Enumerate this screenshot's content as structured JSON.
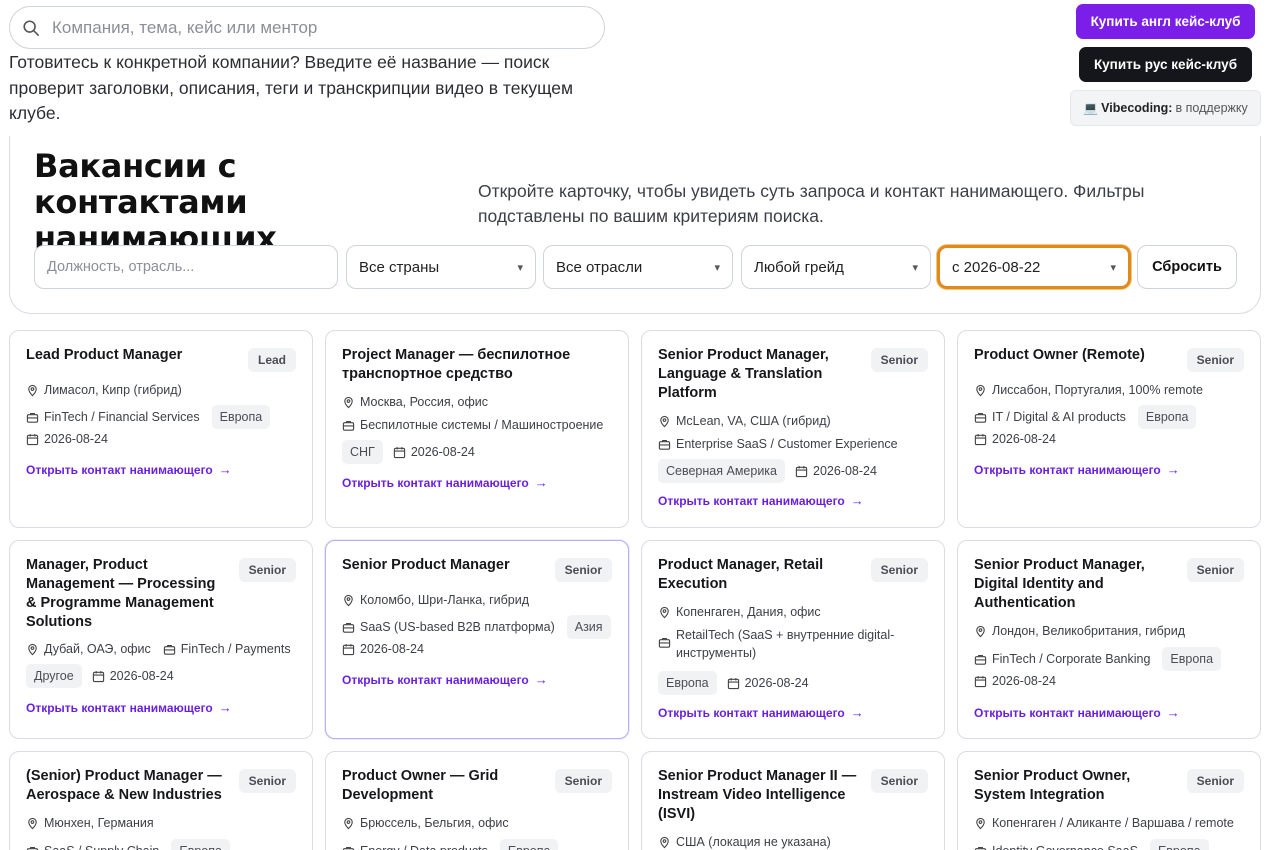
{
  "search": {
    "placeholder": "Компания, тема, кейс или ментор"
  },
  "hint": "Готовитесь к конкретной компании? Введите её название — поиск проверит заголовки, описания, теги и транскрипции видео в текущем клубе.",
  "buttons": {
    "buy_eng": "Купить англ кейс-клуб",
    "buy_rus": "Купить рус кейс-клуб",
    "vibecoding_label": "Vibecoding:",
    "vibecoding_text": "в поддержку"
  },
  "hero": {
    "title": "Вакансии с контактами нанимающих",
    "lead": "Откройте карточку, чтобы увидеть суть запроса и контакт нанимающего. Фильтры подставлены по вашим критериям поиска."
  },
  "filters": {
    "role_placeholder": "Должность, отрасль...",
    "country": "Все страны",
    "industry": "Все отрасли",
    "grade": "Любой грейд",
    "date": "с 2026-08-22",
    "reset": "Сбросить"
  },
  "open_link": "Открыть контакт нанимающего",
  "cards": [
    {
      "title": "Lead Product Manager",
      "grade": "Lead",
      "location": "Лимасол, Кипр (гибрид)",
      "industry": "FinTech / Financial Services",
      "region": "Европа",
      "date": "2026-08-24"
    },
    {
      "title": "Project Manager — беспилотное транспортное средство",
      "grade": "",
      "location": "Москва, Россия, офис",
      "industry": "Беспилотные системы / Машиностроение",
      "region": "СНГ",
      "date": "2026-08-24"
    },
    {
      "title": "Senior Product Manager, Language & Translation Platform",
      "grade": "Senior",
      "location": "McLean, VA, США (гибрид)",
      "industry": "Enterprise SaaS / Customer Experience",
      "region": "Северная Америка",
      "date": "2026-08-24"
    },
    {
      "title": "Product Owner (Remote)",
      "grade": "Senior",
      "location": "Лиссабон, Португалия, 100% remote",
      "industry": "IT / Digital & AI products",
      "region": "Европа",
      "date": "2026-08-24"
    },
    {
      "title": "Manager, Product Management — Processing & Programme Management Solutions",
      "grade": "Senior",
      "location": "Дубай, ОАЭ, офис",
      "industry": "FinTech / Payments",
      "region": "Другое",
      "date": "2026-08-24"
    },
    {
      "title": "Senior Product Manager",
      "grade": "Senior",
      "location": "Коломбо, Шри-Ланка, гибрид",
      "industry": "SaaS (US-based B2B платформа)",
      "region": "Азия",
      "date": "2026-08-24"
    },
    {
      "title": "Product Manager, Retail Execution",
      "grade": "Senior",
      "location": "Копенгаген, Дания, офис",
      "industry": "RetailTech (SaaS + внутренние digital-инструменты)",
      "region": "Европа",
      "date": "2026-08-24"
    },
    {
      "title": "Senior Product Manager, Digital Identity and Authentication",
      "grade": "Senior",
      "location": "Лондон, Великобритания, гибрид",
      "industry": "FinTech / Corporate Banking",
      "region": "Европа",
      "date": "2026-08-24"
    },
    {
      "title": "(Senior) Product Manager — Aerospace & New Industries",
      "grade": "Senior",
      "location": "Мюнхен, Германия",
      "industry": "SaaS / Supply Chain",
      "region": "Европа",
      "date": ""
    },
    {
      "title": "Product Owner — Grid Development",
      "grade": "Senior",
      "location": "Брюссель, Бельгия, офис",
      "industry": "Energy / Data products",
      "region": "Европа",
      "date": ""
    },
    {
      "title": "Senior Product Manager II — Instream Video Intelligence (ISVI)",
      "grade": "Senior",
      "location": "США (локация не указана)",
      "industry": "",
      "region": "",
      "date": ""
    },
    {
      "title": "Senior Product Owner, System Integration",
      "grade": "Senior",
      "location": "Копенгаген / Аликанте / Варшава / remote",
      "industry": "Identity Governance SaaS",
      "region": "Европа",
      "date": ""
    }
  ]
}
